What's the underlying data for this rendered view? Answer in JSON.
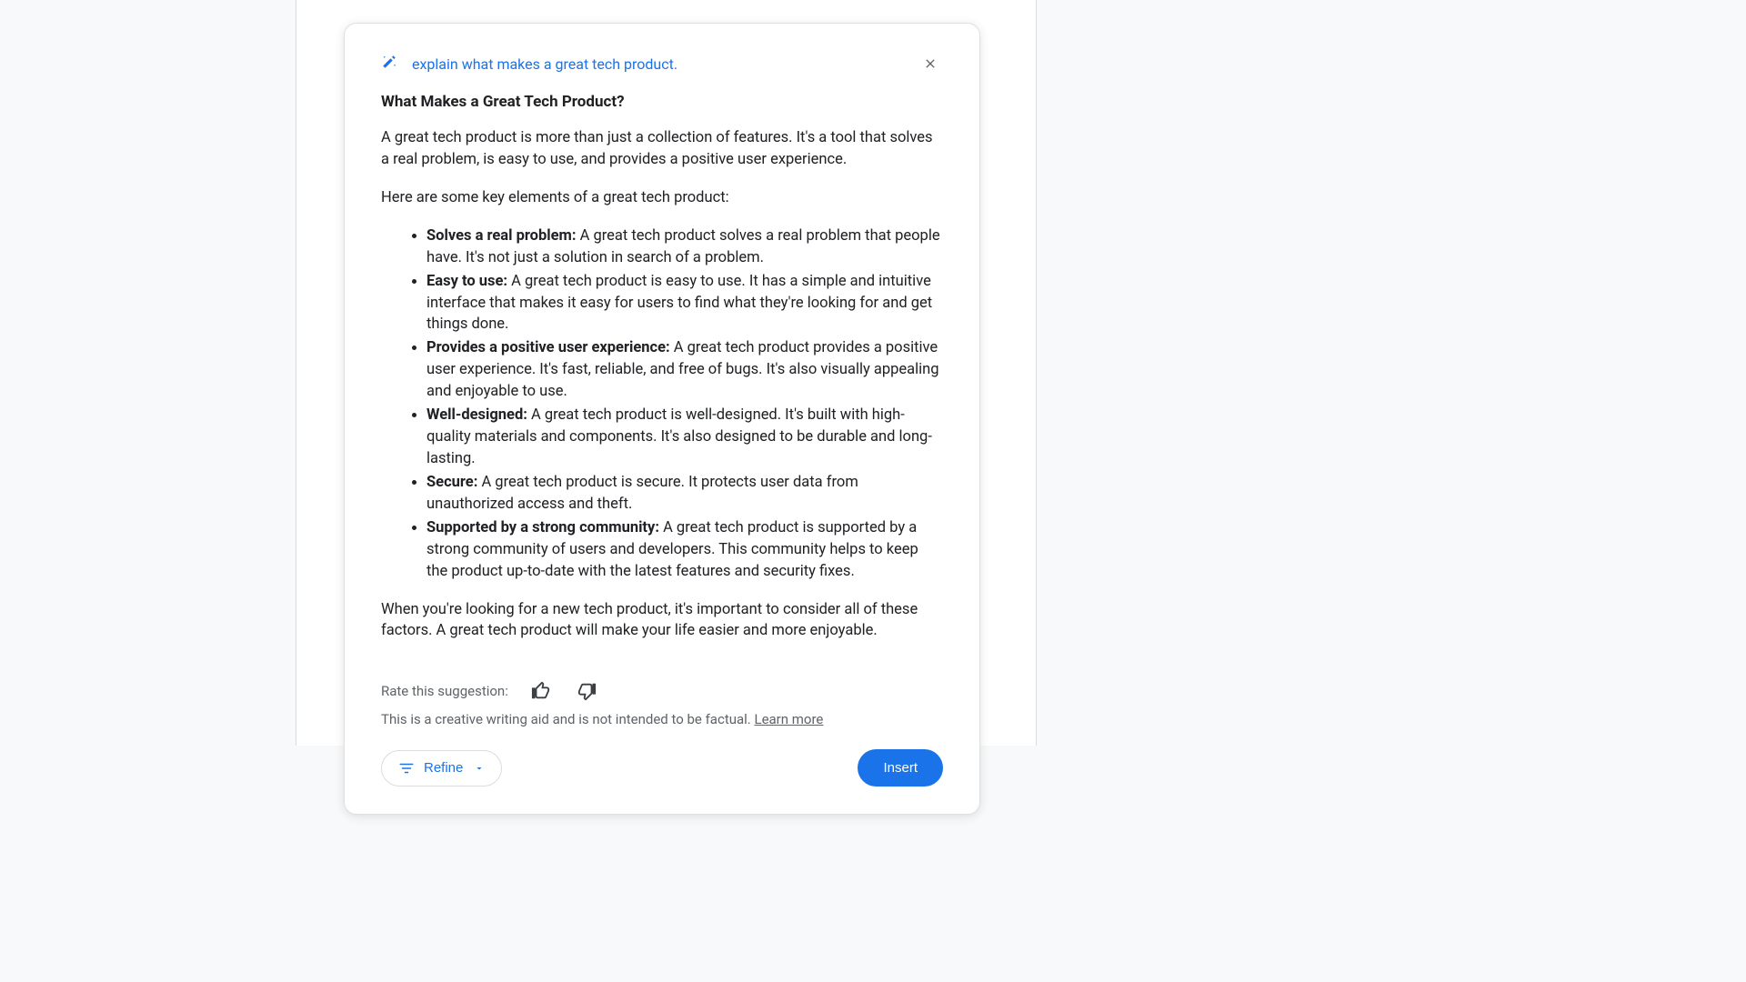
{
  "header": {
    "prompt": "explain what makes a great tech product."
  },
  "content": {
    "heading": "What Makes a Great Tech Product?",
    "intro": "A great tech product is more than just a collection of features. It's a tool that solves a real problem, is easy to use, and provides a positive user experience.",
    "lead_in": "Here are some key elements of a great tech product:",
    "bullets": [
      {
        "title": "Solves a real problem:",
        "text": " A great tech product solves a real problem that people have. It's not just a solution in search of a problem."
      },
      {
        "title": "Easy to use:",
        "text": " A great tech product is easy to use. It has a simple and intuitive interface that makes it easy for users to find what they're looking for and get things done."
      },
      {
        "title": "Provides a positive user experience:",
        "text": " A great tech product provides a positive user experience. It's fast, reliable, and free of bugs. It's also visually appealing and enjoyable to use."
      },
      {
        "title": "Well-designed:",
        "text": " A great tech product is well-designed. It's built with high-quality materials and components. It's also designed to be durable and long-lasting."
      },
      {
        "title": "Secure:",
        "text": " A great tech product is secure. It protects user data from unauthorized access and theft."
      },
      {
        "title": "Supported by a strong community:",
        "text": " A great tech product is supported by a strong community of users and developers. This community helps to keep the product up-to-date with the latest features and security fixes."
      }
    ],
    "outro": "When you're looking for a new tech product, it's important to consider all of these factors. A great tech product will make your life easier and more enjoyable."
  },
  "footer": {
    "rate_label": "Rate this suggestion:",
    "disclaimer_text": "This is a creative writing aid and is not intended to be factual. ",
    "learn_more": "Learn more",
    "refine_label": "Refine",
    "insert_label": "Insert"
  },
  "colors": {
    "accent": "#1a73e8"
  }
}
